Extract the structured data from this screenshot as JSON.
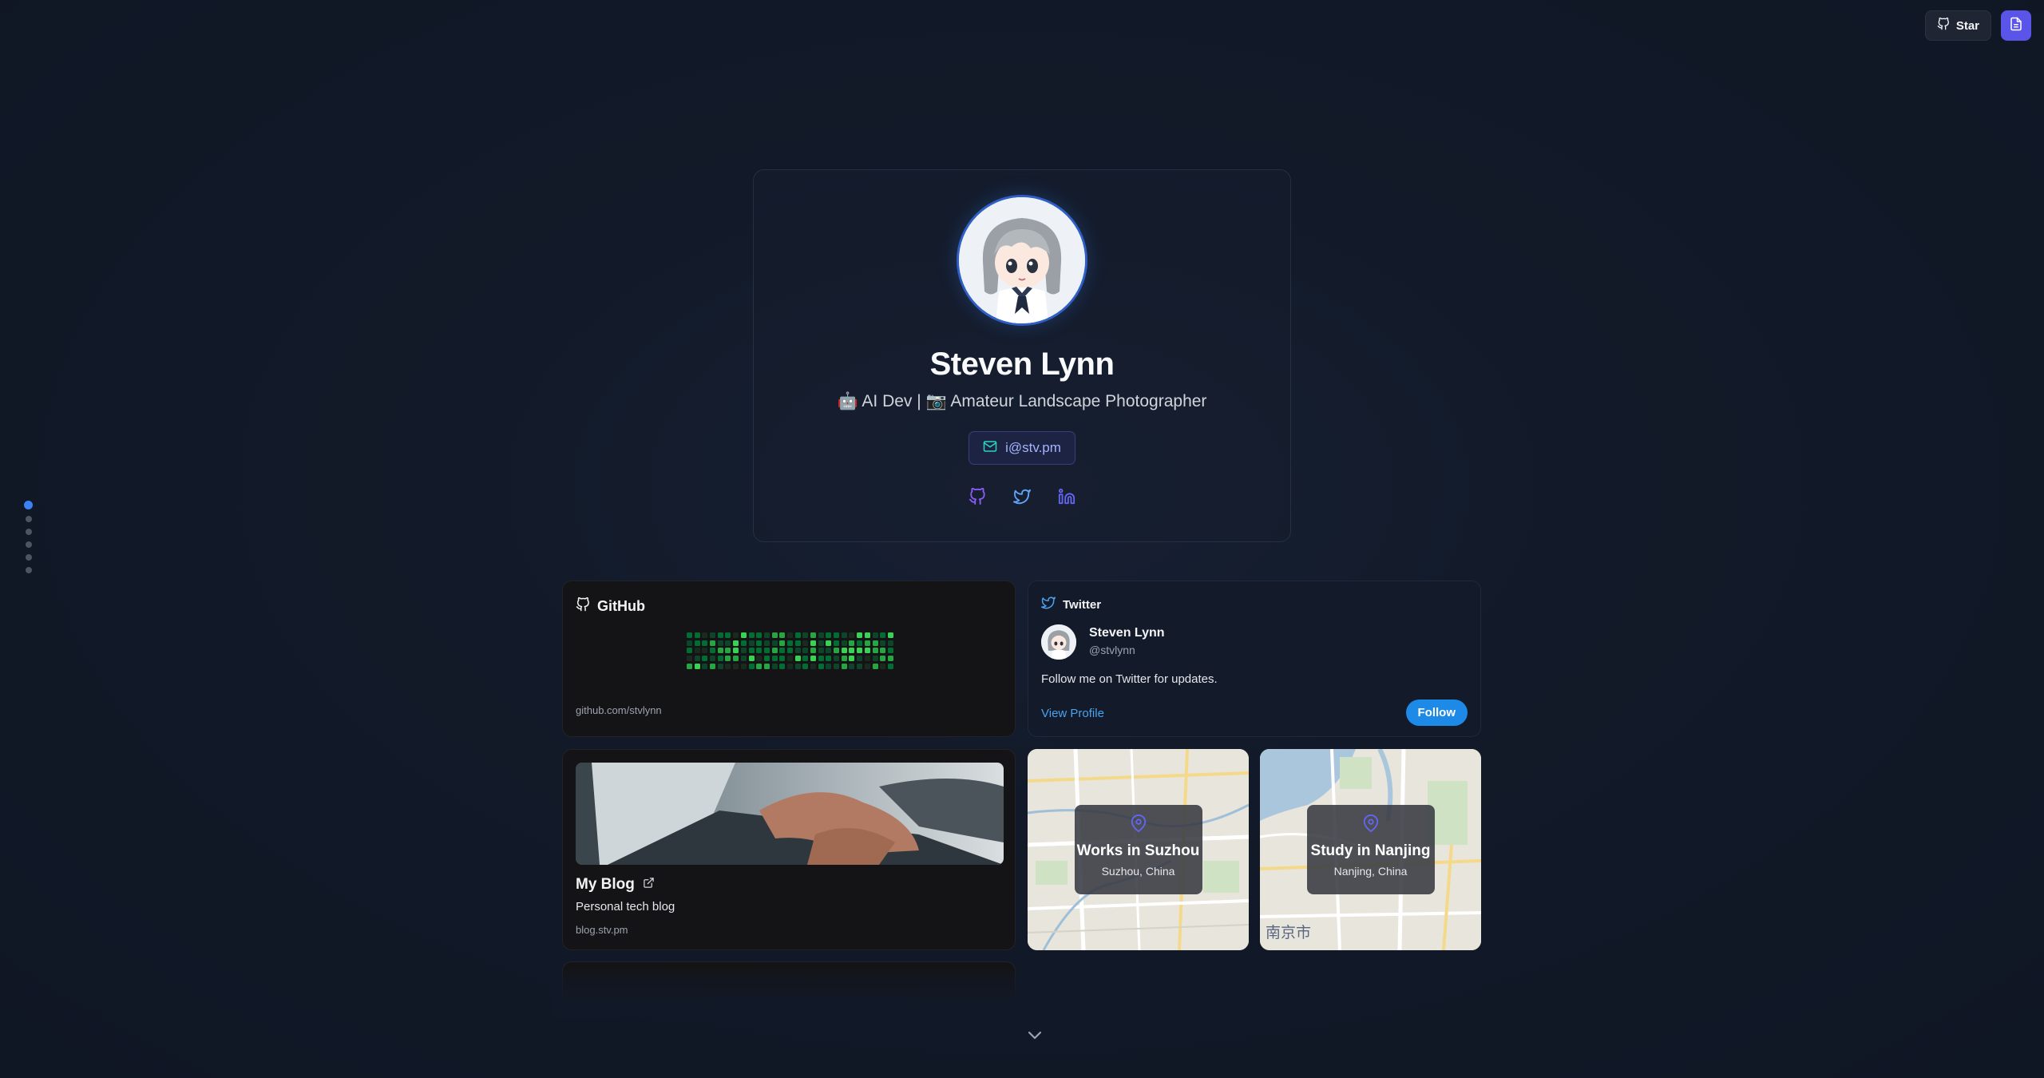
{
  "topbar": {
    "star_label": "Star"
  },
  "profile": {
    "name": "Steven Lynn",
    "tagline": "🤖 AI Dev | 📷 Amateur Landscape Photographer",
    "email": "i@stv.pm",
    "socials": [
      "github-icon",
      "twitter-icon",
      "linkedin-icon"
    ]
  },
  "github": {
    "title": "GitHub",
    "url": "github.com/stvlynn"
  },
  "twitter": {
    "title": "Twitter",
    "name": "Steven Lynn",
    "handle": "@stvlynn",
    "text": "Follow me on Twitter for updates.",
    "view_profile": "View Profile",
    "follow": "Follow"
  },
  "blog": {
    "title": "My Blog",
    "description": "Personal tech blog",
    "url": "blog.stv.pm"
  },
  "locations": [
    {
      "title": "Works in Suzhou",
      "sub": "Suzhou, China",
      "map_city": ""
    },
    {
      "title": "Study in Nanjing",
      "sub": "Nanjing, China",
      "map_city": "南京市"
    }
  ],
  "colors": {
    "accent": "#3b82f6",
    "button_purple": "#5b54e8",
    "twitter_blue": "#1d8ae8",
    "contribution_green": "#39d353"
  }
}
